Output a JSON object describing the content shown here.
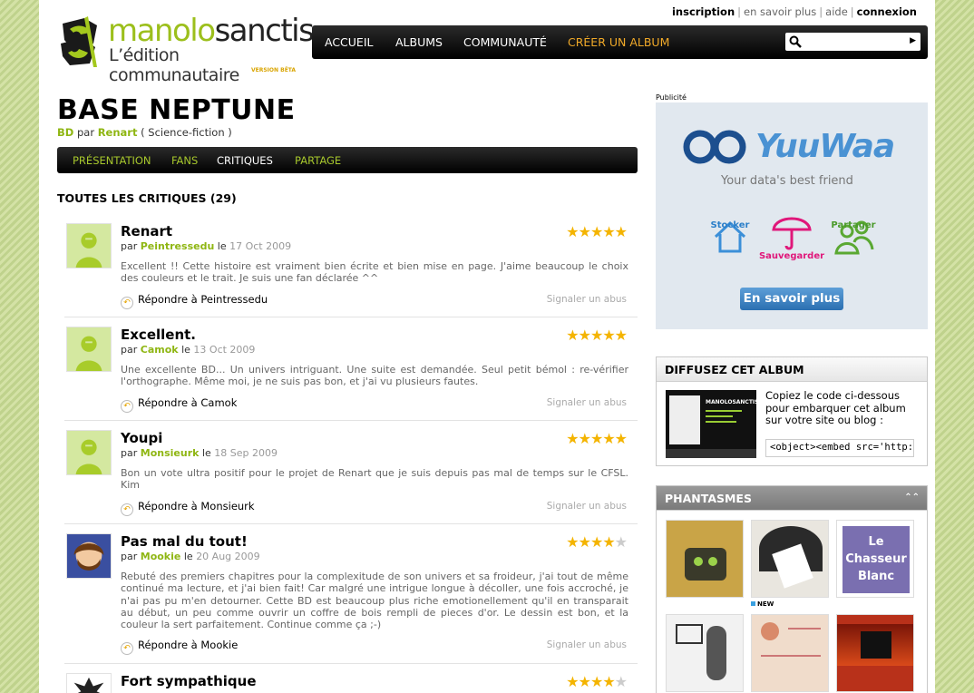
{
  "header": {
    "toplinks": {
      "signup": "inscription",
      "learn_more": "en savoir plus",
      "help": "aide",
      "login": "connexion"
    },
    "logo": {
      "name_a": "manolo",
      "name_b": "sanctis",
      "subtitle": "L’édition communautaire",
      "beta": "VERSION BÊTA"
    },
    "nav": {
      "items": [
        "ACCUEIL",
        "ALBUMS",
        "COMMUNAUTÉ",
        "CRÉER UN ALBUM"
      ],
      "search_placeholder": ""
    }
  },
  "album": {
    "title": "BASE NEPTUNE",
    "type": "BD",
    "by": "par",
    "author": "Renart",
    "genre": "( Science-fiction )",
    "tabs": [
      "PRÉSENTATION",
      "FANS",
      "CRITIQUES",
      "PARTAGE"
    ],
    "active_tab": "CRITIQUES"
  },
  "reviews_heading": "TOUTES LES CRITIQUES (29)",
  "reviews": [
    {
      "title": "Renart",
      "by": "par",
      "user": "Peintressedu",
      "le": "le",
      "date": "17 Oct 2009",
      "rating": 5,
      "text": "Excellent !! Cette histoire est vraiment bien écrite et bien mise en page. J'aime beaucoup le choix des couleurs et le trait. Je suis une fan déclarée ^^",
      "reply": "Répondre à Peintressedu",
      "report": "Signaler un abus"
    },
    {
      "title": "Excellent.",
      "by": "par",
      "user": "Camok",
      "le": "le",
      "date": "13 Oct 2009",
      "rating": 5,
      "text": "Une excellente BD... Un univers intriguant. Une suite est demandée. Seul petit bémol : re-vérifier l'orthographe. Même moi, je ne suis pas bon, et j'ai vu plusieurs fautes.",
      "reply": "Répondre à Camok",
      "report": "Signaler un abus"
    },
    {
      "title": "Youpi",
      "by": "par",
      "user": "Monsieurk",
      "le": "le",
      "date": "18 Sep 2009",
      "rating": 5,
      "text": "Bon un vote ultra positif pour le projet de Renart que je suis depuis pas mal de temps sur le CFSL. Kim",
      "reply": "Répondre à Monsieurk",
      "report": "Signaler un abus"
    },
    {
      "title": "Pas mal du tout!",
      "by": "par",
      "user": "Mookie",
      "le": "le",
      "date": "20 Aug 2009",
      "rating": 4,
      "text": "Rebuté des premiers chapitres pour la complexitude de son univers et sa froideur, j'ai tout de même continué ma lecture, et j'ai bien fait! Car malgré une intrigue longue à décoller, une fois accroché, je n'ai pas pu m'en detourner. Cette BD est beaucoup plus riche emotionellement qu'il en transparait au début, un peu comme ouvrir un coffre de bois rempli de pieces d'or. Le dessin est bon, et la couleur la sert parfaitement. Continue comme ça ;-)",
      "reply": "Répondre à Mookie",
      "report": "Signaler un abus"
    },
    {
      "title": "Fort sympathique",
      "rating": 4
    }
  ],
  "sidebar": {
    "ad_label": "Publicité",
    "ad": {
      "brand": "YuuWaa",
      "tagline": "Your data's best friend",
      "features": [
        "Stocker",
        "Sauvegarder",
        "Partager"
      ],
      "cta": "En savoir plus"
    },
    "diffuse": {
      "title": "DIFFUSEZ CET ALBUM",
      "text": "Copiez le code ci-dessous pour embarquer cet album sur votre site ou blog :",
      "code": "<object><embed src='http:",
      "thumb_brand": "MANOLOSANCTIS"
    },
    "phantasmes": {
      "title": "PHANTASMES",
      "new_label": "NEW",
      "thumb3_title": "Le Chasseur Blanc"
    }
  },
  "colors": {
    "accent_green": "#8fb613",
    "nav_active": "#f0a928",
    "star": "#f4b400"
  }
}
